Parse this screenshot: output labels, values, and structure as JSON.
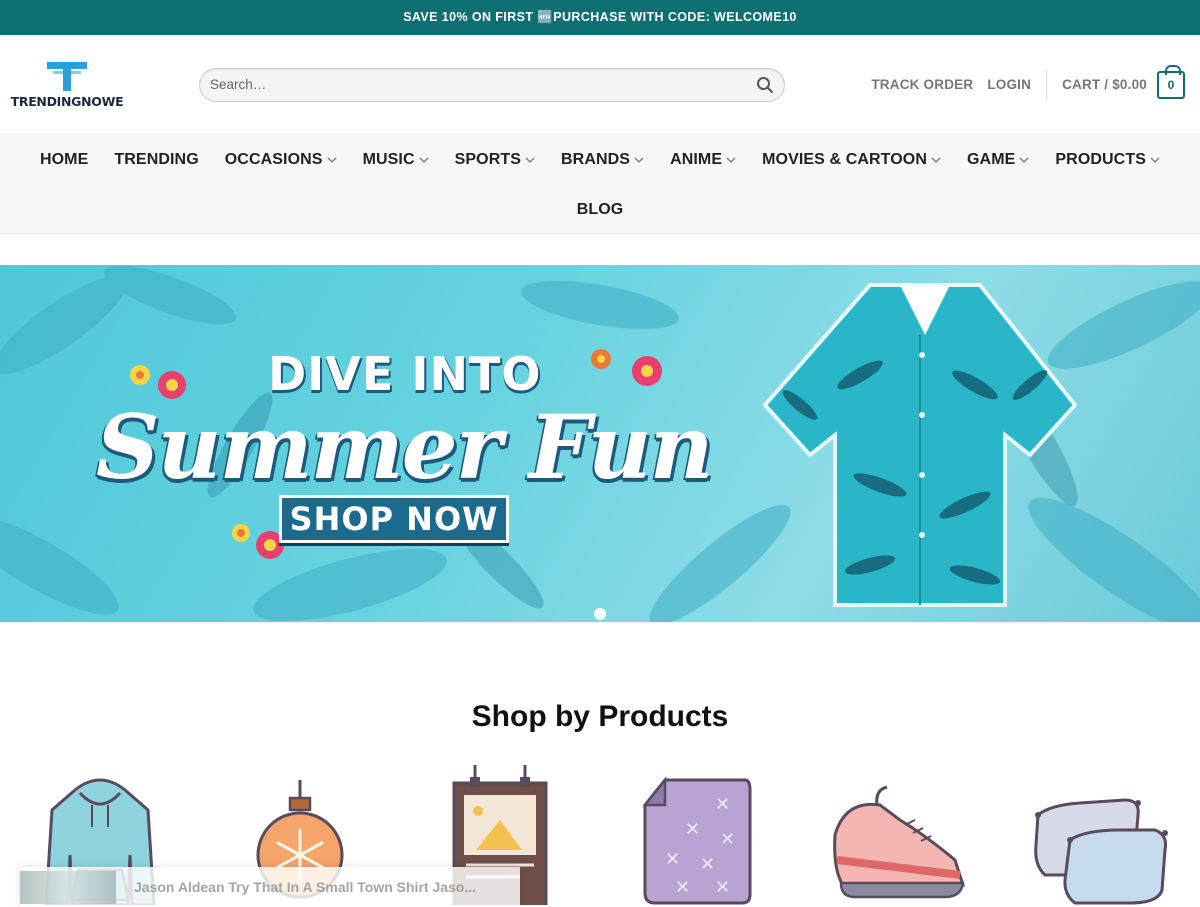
{
  "topbar": {
    "promo": "SAVE 10% ON FIRST 🆕PURCHASE WITH CODE: WELCOME10"
  },
  "header": {
    "logo_text": "TRENDINGNOWE",
    "search_placeholder": "Search…",
    "track_order": "TRACK ORDER",
    "login": "LOGIN",
    "cart_label": "CART / $0.00",
    "cart_count": "0"
  },
  "nav": {
    "row1": [
      {
        "label": "HOME",
        "dropdown": false
      },
      {
        "label": "TRENDING",
        "dropdown": false
      },
      {
        "label": "OCCASIONS",
        "dropdown": true
      },
      {
        "label": "MUSIC",
        "dropdown": true
      },
      {
        "label": "SPORTS",
        "dropdown": true
      },
      {
        "label": "BRANDS",
        "dropdown": true
      },
      {
        "label": "ANIME",
        "dropdown": true
      },
      {
        "label": "MOVIES & CARTOON",
        "dropdown": true
      },
      {
        "label": "GAME",
        "dropdown": true
      },
      {
        "label": "PRODUCTS",
        "dropdown": true
      }
    ],
    "row2": [
      {
        "label": "BLOG",
        "dropdown": false
      }
    ]
  },
  "hero": {
    "line1": "DIVE INTO",
    "line2": "Summer Fun",
    "button": "SHOP NOW",
    "slide_count": 1
  },
  "shop_by_products": {
    "title": "Shop by Products",
    "items": [
      "hoodie-icon",
      "ornament-icon",
      "poster-icon",
      "blanket-icon",
      "shoe-icon",
      "pillow-icon"
    ]
  },
  "toast": {
    "text": "Jason Aldean Try That In A Small Town Shirt Jaso..."
  },
  "colors": {
    "brand": "#0d6f72",
    "hero_bg": "#5ccfdd"
  }
}
